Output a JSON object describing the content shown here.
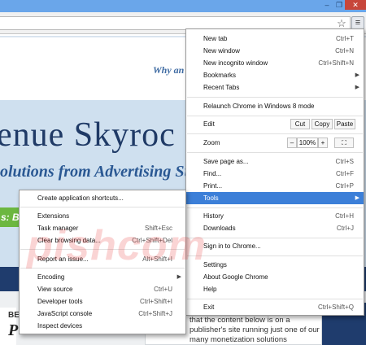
{
  "window": {
    "minimize_glyph": "–",
    "restore_glyph": "❐",
    "close_glyph": "✕"
  },
  "toolbar": {
    "star_icon": "☆",
    "menu_icon": "≡"
  },
  "page": {
    "tagline": "Why an",
    "hero_heading": "enue Skyroc",
    "hero_subtitle": "olutions from Advertising Sup",
    "green_bar": "s: B",
    "left_heading": "BE",
    "left_title": "P",
    "article_text": "that the content below is on a publisher's site running just one of our many monetization solutions"
  },
  "watermark": "pishcom",
  "main_menu": {
    "new_tab": {
      "label": "New tab",
      "shortcut": "Ctrl+T"
    },
    "new_window": {
      "label": "New window",
      "shortcut": "Ctrl+N"
    },
    "new_incognito": {
      "label": "New incognito window",
      "shortcut": "Ctrl+Shift+N"
    },
    "bookmarks": {
      "label": "Bookmarks"
    },
    "recent_tabs": {
      "label": "Recent Tabs"
    },
    "relaunch": {
      "label": "Relaunch Chrome in Windows 8 mode"
    },
    "edit": {
      "label": "Edit",
      "cut": "Cut",
      "copy": "Copy",
      "paste": "Paste"
    },
    "zoom": {
      "label": "Zoom",
      "minus": "–",
      "value": "100%",
      "plus": "+",
      "fullscreen": "⛶"
    },
    "save_page": {
      "label": "Save page as...",
      "shortcut": "Ctrl+S"
    },
    "find": {
      "label": "Find...",
      "shortcut": "Ctrl+F"
    },
    "print": {
      "label": "Print...",
      "shortcut": "Ctrl+P"
    },
    "tools": {
      "label": "Tools"
    },
    "history": {
      "label": "History",
      "shortcut": "Ctrl+H"
    },
    "downloads": {
      "label": "Downloads",
      "shortcut": "Ctrl+J"
    },
    "sign_in": {
      "label": "Sign in to Chrome..."
    },
    "settings": {
      "label": "Settings"
    },
    "about": {
      "label": "About Google Chrome"
    },
    "help": {
      "label": "Help"
    },
    "exit": {
      "label": "Exit",
      "shortcut": "Ctrl+Shift+Q"
    },
    "arrow": "▶"
  },
  "tools_menu": {
    "create_shortcuts": {
      "label": "Create application shortcuts..."
    },
    "extensions": {
      "label": "Extensions"
    },
    "task_manager": {
      "label": "Task manager",
      "shortcut": "Shift+Esc"
    },
    "clear_data": {
      "label": "Clear browsing data...",
      "shortcut": "Ctrl+Shift+Del"
    },
    "report_issue": {
      "label": "Report an issue...",
      "shortcut": "Alt+Shift+I"
    },
    "encoding": {
      "label": "Encoding"
    },
    "view_source": {
      "label": "View source",
      "shortcut": "Ctrl+U"
    },
    "dev_tools": {
      "label": "Developer tools",
      "shortcut": "Ctrl+Shift+I"
    },
    "js_console": {
      "label": "JavaScript console",
      "shortcut": "Ctrl+Shift+J"
    },
    "inspect_devices": {
      "label": "Inspect devices"
    }
  }
}
